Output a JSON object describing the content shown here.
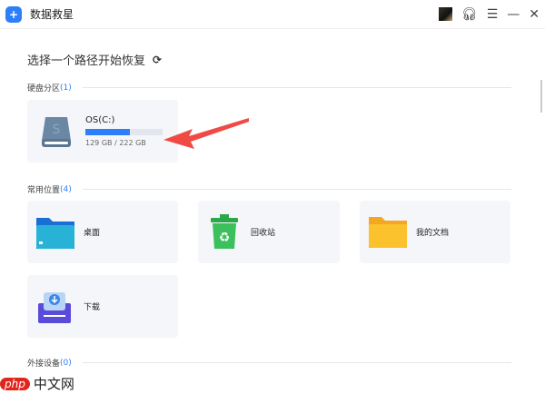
{
  "app": {
    "title": "数据救星"
  },
  "main": {
    "heading": "选择一个路径开始恢复"
  },
  "sections": {
    "disks": {
      "label": "硬盘分区",
      "count": "(1)"
    },
    "common": {
      "label": "常用位置",
      "count": "(4)"
    },
    "external": {
      "label": "外接设备",
      "count": "(0)"
    }
  },
  "disk": {
    "name": "OS(C:)",
    "usage": "129 GB / 222 GB",
    "used_percent": 58
  },
  "locations": [
    {
      "label": "桌面"
    },
    {
      "label": "回收站"
    },
    {
      "label": "我的文档"
    },
    {
      "label": "下载"
    }
  ],
  "watermark": {
    "text": "php中文网"
  },
  "colors": {
    "accent": "#2d7ff9",
    "arrow": "#f04a45"
  }
}
